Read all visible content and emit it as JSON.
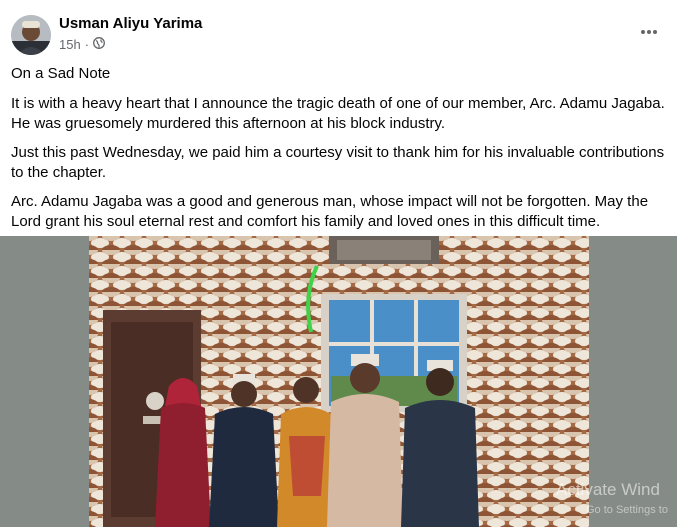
{
  "post": {
    "author": "Usman Aliyu Yarima",
    "time": "15h",
    "separator": "·",
    "privacy_icon": "globe-icon",
    "more_icon": "more-horizontal-icon",
    "paragraphs": [
      "On a Sad Note",
      "It is with a heavy heart that I announce the tragic death of one of our member, Arc. Adamu Jagaba. He was gruesomely murdered this afternoon at his block industry.",
      "Just this past Wednesday, we paid him a courtesy visit to thank him for his invaluable contributions to the chapter.",
      "Arc. Adamu Jagaba was a good and generous man, whose impact will not be forgotten. May the Lord grant his soul eternal rest and comfort his family and loved ones in this difficult time."
    ]
  },
  "overlay": {
    "activate_line1": "Activate Wind",
    "activate_line2": "Go to Settings to"
  },
  "colors": {
    "text": "#050505",
    "secondary": "#65676b",
    "photo_backdrop": "#858b87"
  }
}
